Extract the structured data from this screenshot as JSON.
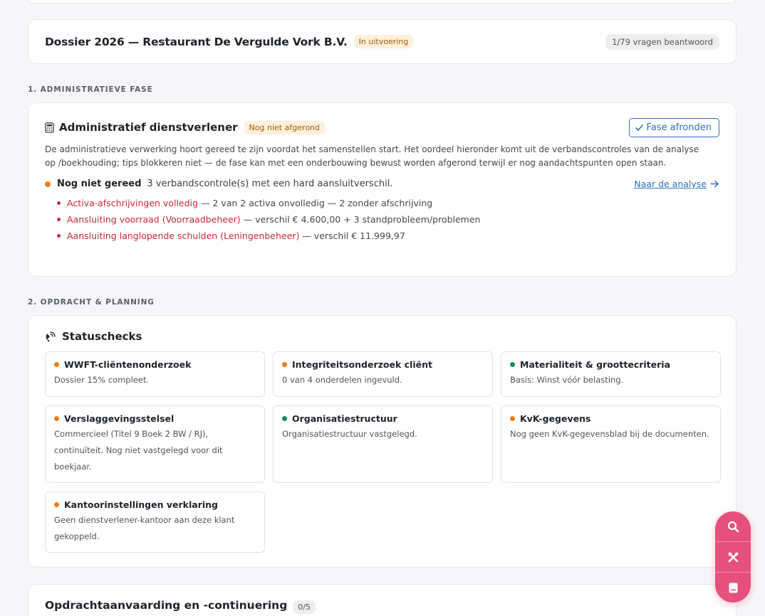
{
  "dossier": {
    "title": "Dossier 2026 — Restaurant De Vergulde Vork B.V.",
    "status_badge": "In uitvoering",
    "progress_label": "1/79 vragen beantwoord"
  },
  "sections": {
    "admin_label": "1. ADMINISTRATIEVE FASE",
    "planning_label": "2. OPDRACHT & PLANNING"
  },
  "phase": {
    "icon": "calculator-icon",
    "title": "Administratief dienstverlener",
    "badge": "Nog niet afgerond",
    "button_label": "Fase afronden",
    "description": "De administratieve verwerking hoort gereed te zijn voordat het samenstellen start. Het oordeel hieronder komt uit de verbandscontroles van de analyse op /boekhouding; tips blokkeren niet — de fase kan met een onderbouwing bewust worden afgerond terwijl er nog aandachtspunten open staan.",
    "status_strong": "Nog niet gereed",
    "status_text": "3 verbandscontrole(s) met een hard aansluitverschil.",
    "link_label": "Naar de analyse",
    "issues": [
      {
        "label": "Activa-afschrijvingen volledig",
        "detail": "— 2 van 2 activa onvolledig — 2 zonder afschrijving"
      },
      {
        "label": "Aansluiting voorraad (Voorraadbeheer)",
        "detail": "— verschil € 4.600,00 + 3 standprobleem/problemen"
      },
      {
        "label": "Aansluiting langlopende schulden (Leningenbeheer)",
        "detail": "— verschil € 11.999,97"
      }
    ]
  },
  "statuschecks": {
    "title": "Statuschecks",
    "tiles": [
      {
        "title": "WWFT-cliëntenonderzoek",
        "body": "Dossier 15% compleet.",
        "status": "orange"
      },
      {
        "title": "Integriteitsonderzoek cliënt",
        "body": "0 van 4 onderdelen ingevuld.",
        "status": "orange"
      },
      {
        "title": "Materialiteit & groottecriteria",
        "body": "Basis: Winst vóór belasting.",
        "status": "green"
      },
      {
        "title": "Verslaggevingsstelsel",
        "body": "Commercieel (Titel 9 Boek 2 BW / RJ), continuïteit. Nog niet vastgelegd voor dit boekjaar.",
        "status": "orange"
      },
      {
        "title": "Organisatiestructuur",
        "body": "Organisatiestructuur vastgelegd.",
        "status": "green"
      },
      {
        "title": "KvK-gegevens",
        "body": "Nog geen KvK-gegevensblad bij de documenten.",
        "status": "orange"
      },
      {
        "title": "Kantoorinstellingen verklaring",
        "body": "Geen dienstverlener-kantoor aan deze klant gekoppeld.",
        "status": "orange"
      }
    ]
  },
  "next_section": {
    "title": "Opdrachtaanvaarding en -continuering",
    "count": "0/5"
  },
  "fab": {
    "icons": [
      "search-icon",
      "tools-icon",
      "book-icon"
    ]
  },
  "colors": {
    "accent": "#2f6fbd",
    "warning": "#f07c14",
    "ok": "#168a55",
    "danger": "#c9283a",
    "fab": "#e6507f"
  }
}
